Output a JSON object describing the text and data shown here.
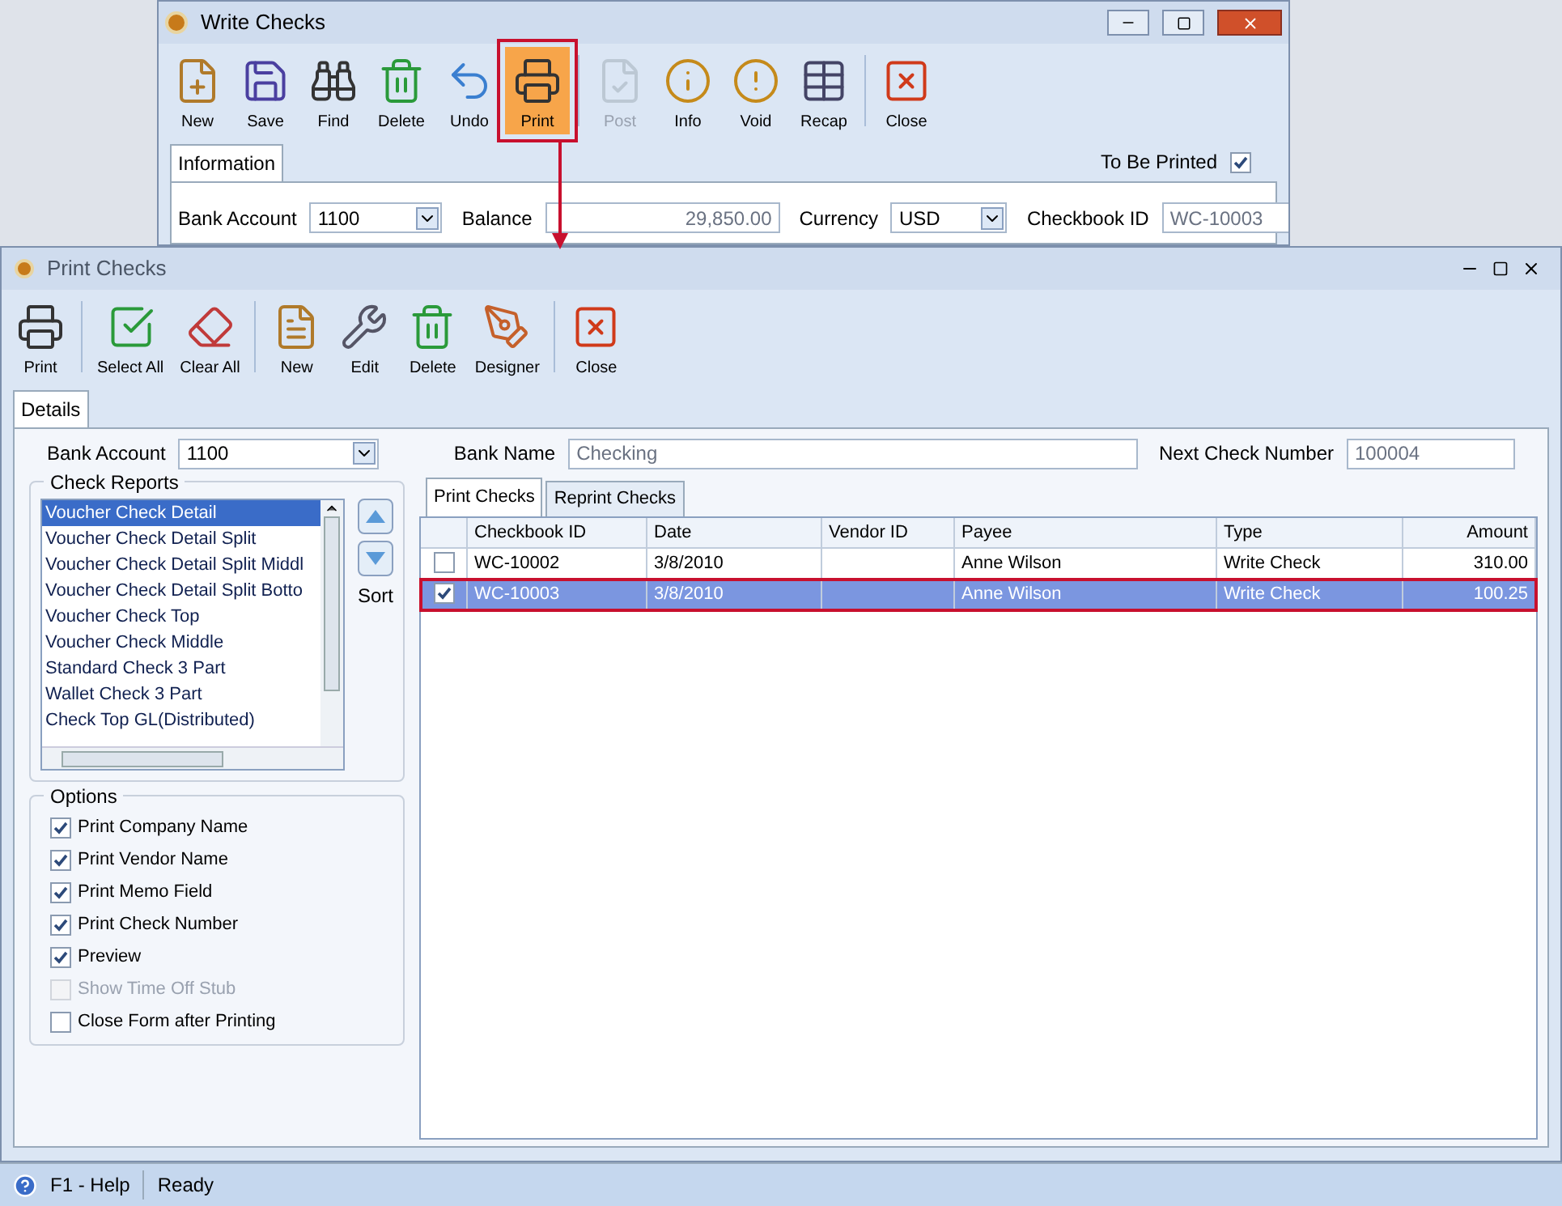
{
  "write_checks": {
    "title": "Write Checks",
    "toolbar": [
      {
        "label": "New",
        "disabled": false,
        "selected": false
      },
      {
        "label": "Save",
        "disabled": false,
        "selected": false
      },
      {
        "label": "Find",
        "disabled": false,
        "selected": false
      },
      {
        "label": "Delete",
        "disabled": false,
        "selected": false
      },
      {
        "label": "Undo",
        "disabled": false,
        "selected": false
      },
      {
        "label": "Print",
        "disabled": false,
        "selected": true
      },
      {
        "label": "Post",
        "disabled": true,
        "selected": false
      },
      {
        "label": "Info",
        "disabled": false,
        "selected": false
      },
      {
        "label": "Void",
        "disabled": false,
        "selected": false
      },
      {
        "label": "Recap",
        "disabled": false,
        "selected": false
      },
      {
        "label": "Close",
        "disabled": false,
        "selected": false
      }
    ],
    "tab": "Information",
    "to_be_printed": {
      "label": "To Be Printed",
      "checked": true
    },
    "fields": [
      {
        "label": "Bank Account",
        "value": "1100",
        "kind": "dropdown"
      },
      {
        "label": "Balance",
        "value": "29,850.00",
        "kind": "number"
      },
      {
        "label": "Currency",
        "value": "USD",
        "kind": "dropdown"
      },
      {
        "label": "Checkbook ID",
        "value": "WC-10003",
        "kind": "text"
      }
    ]
  },
  "print_checks": {
    "title": "Print Checks",
    "toolbar": [
      {
        "label": "Print"
      },
      {
        "label": "Select All"
      },
      {
        "label": "Clear All"
      },
      {
        "label": "New"
      },
      {
        "label": "Edit"
      },
      {
        "label": "Delete"
      },
      {
        "label": "Designer"
      },
      {
        "label": "Close"
      }
    ],
    "tab": "Details",
    "bank_account": {
      "label": "Bank Account",
      "value": "1100"
    },
    "bank_name": {
      "label": "Bank Name",
      "value": "Checking"
    },
    "next_check_number": {
      "label": "Next Check Number",
      "value": "100004"
    },
    "check_reports": {
      "title": "Check Reports",
      "sort_label": "Sort",
      "items": [
        {
          "label": "Voucher Check Detail",
          "selected": true
        },
        {
          "label": "Voucher Check Detail Split",
          "selected": false
        },
        {
          "label": "Voucher Check Detail Split Middl",
          "selected": false
        },
        {
          "label": "Voucher Check Detail Split Botto",
          "selected": false
        },
        {
          "label": "Voucher Check Top",
          "selected": false
        },
        {
          "label": "Voucher Check Middle",
          "selected": false
        },
        {
          "label": "Standard Check 3 Part",
          "selected": false
        },
        {
          "label": "Wallet Check 3 Part",
          "selected": false
        },
        {
          "label": "Check Top GL(Distributed)",
          "selected": false
        }
      ]
    },
    "options": {
      "title": "Options",
      "items": [
        {
          "label": "Print Company Name",
          "checked": true,
          "disabled": false
        },
        {
          "label": "Print Vendor Name",
          "checked": true,
          "disabled": false
        },
        {
          "label": "Print Memo Field",
          "checked": true,
          "disabled": false
        },
        {
          "label": "Print Check Number",
          "checked": true,
          "disabled": false
        },
        {
          "label": "Preview",
          "checked": true,
          "disabled": false
        },
        {
          "label": "Show Time Off Stub",
          "checked": false,
          "disabled": true
        },
        {
          "label": "Close Form after Printing",
          "checked": false,
          "disabled": false
        }
      ]
    },
    "grid_tabs": [
      {
        "label": "Print Checks",
        "selected": true
      },
      {
        "label": "Reprint Checks",
        "selected": false
      }
    ],
    "table": {
      "columns": [
        "Checkbook ID",
        "Date",
        "Vendor ID",
        "Payee",
        "Type",
        "Amount"
      ],
      "rows": [
        {
          "checked": false,
          "selected": false,
          "cells": [
            "WC-10002",
            "3/8/2010",
            "",
            "Anne Wilson",
            "Write Check",
            "310.00"
          ]
        },
        {
          "checked": true,
          "selected": true,
          "cells": [
            "WC-10003",
            "3/8/2010",
            "",
            "Anne Wilson",
            "Write Check",
            "100.25"
          ]
        }
      ]
    }
  },
  "status_bar": {
    "help": "F1 - Help",
    "status": "Ready"
  }
}
